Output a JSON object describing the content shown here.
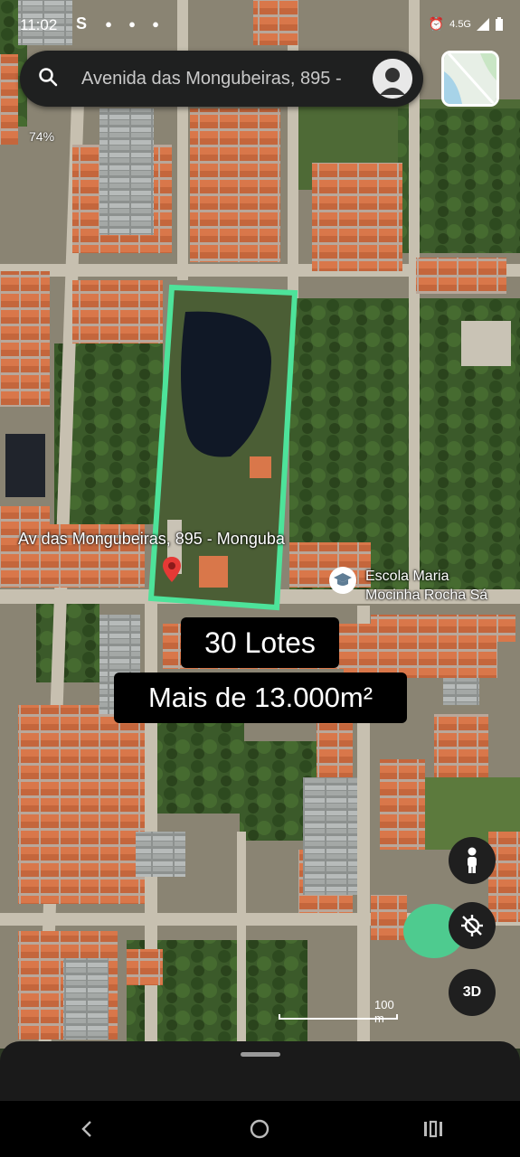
{
  "status_bar": {
    "time": "11:02",
    "carrier_icon": "S",
    "network": "4.5G",
    "battery_icon": "battery-icon"
  },
  "search": {
    "query": "Avenida das Mongubeiras, 895 -",
    "search_icon": "search-icon"
  },
  "map": {
    "zoom_hint": "74%",
    "place_label": "Av das Mongubeiras, 895 - Monguba",
    "poi_label_line1": "Escola Maria",
    "poi_label_line2": "Mocinha Rocha Sá",
    "scale_text": "100 m",
    "colors": {
      "highlight": "#4de39a",
      "pin": "#e53935",
      "roof": "#d9774a"
    }
  },
  "overlay": {
    "line1": "30 Lotes",
    "line2": "Mais de 13.000m²"
  },
  "controls": {
    "view_3d_label": "3D"
  }
}
